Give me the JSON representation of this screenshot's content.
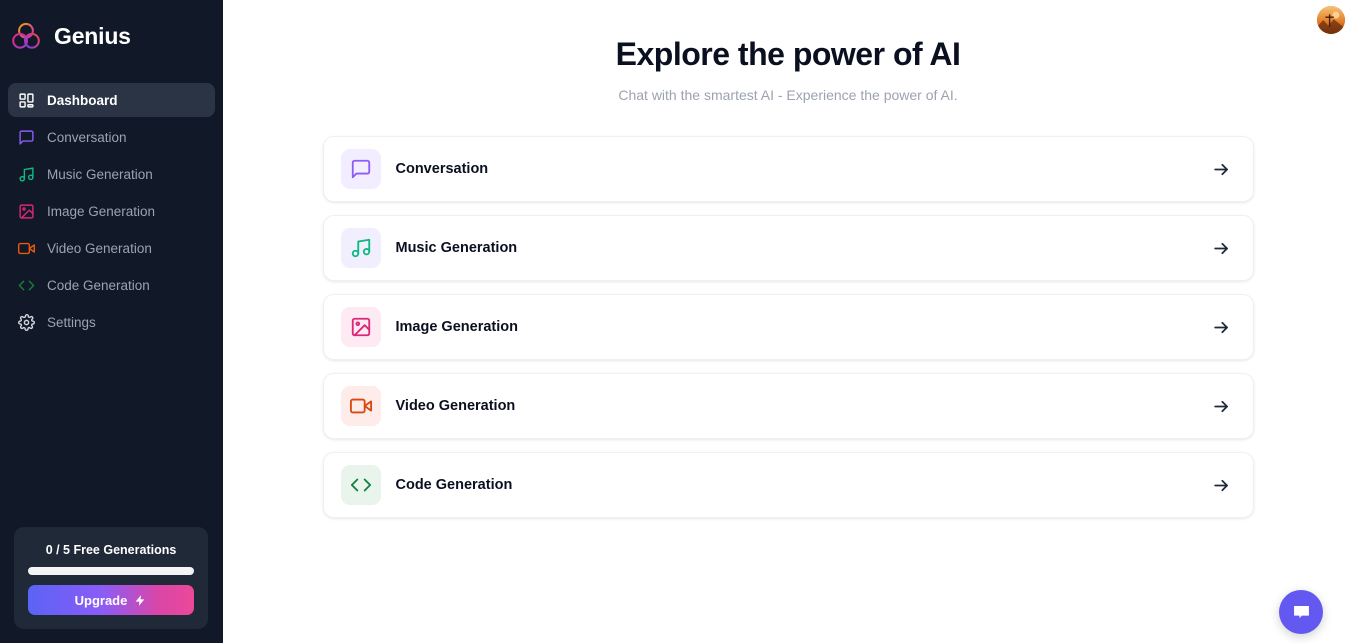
{
  "brand": {
    "name": "Genius",
    "logo_icon": "trefoil-circles-logo"
  },
  "sidebar": {
    "items": [
      {
        "label": "Dashboard",
        "icon": "layout-dashboard-icon",
        "active": true,
        "color": "#ffffff"
      },
      {
        "label": "Conversation",
        "icon": "message-square-icon",
        "active": false,
        "color": "#8b5cf6"
      },
      {
        "label": "Music Generation",
        "icon": "music-note-icon",
        "active": false,
        "color": "#10b981"
      },
      {
        "label": "Image Generation",
        "icon": "image-icon",
        "active": false,
        "color": "#db2777"
      },
      {
        "label": "Video Generation",
        "icon": "video-camera-icon",
        "active": false,
        "color": "#ea580c"
      },
      {
        "label": "Code Generation",
        "icon": "code-brackets-icon",
        "active": false,
        "color": "#15803d"
      },
      {
        "label": "Settings",
        "icon": "gear-icon",
        "active": false,
        "color": "#d1d5db"
      }
    ],
    "free_card": {
      "counter_text": "0 / 5 Free Generations",
      "progress_percent": 0,
      "upgrade_label": "Upgrade",
      "upgrade_icon": "zap-bolt-icon"
    }
  },
  "header": {
    "avatar_icon": "user-avatar"
  },
  "hero": {
    "title": "Explore the power of AI",
    "subtitle": "Chat with the smartest AI - Experience the power of AI."
  },
  "tools": [
    {
      "label": "Conversation",
      "icon": "message-square-icon",
      "icon_color": "#8b5cf6",
      "icon_bg": "#f3eeff",
      "arrow_icon": "arrow-right-icon"
    },
    {
      "label": "Music Generation",
      "icon": "music-note-icon",
      "icon_color": "#10b981",
      "icon_bg": "#f1eefe",
      "arrow_icon": "arrow-right-icon"
    },
    {
      "label": "Image Generation",
      "icon": "image-icon",
      "icon_color": "#db2777",
      "icon_bg": "#fdeaf3",
      "arrow_icon": "arrow-right-icon"
    },
    {
      "label": "Video Generation",
      "icon": "video-camera-icon",
      "icon_color": "#d9480f",
      "icon_bg": "#fdecea",
      "arrow_icon": "arrow-right-icon"
    },
    {
      "label": "Code Generation",
      "icon": "code-brackets-icon",
      "icon_color": "#15803d",
      "icon_bg": "#e9f4ec",
      "arrow_icon": "arrow-right-icon"
    }
  ],
  "chat_widget": {
    "icon": "chat-bubble-icon",
    "color": "#6359f0"
  },
  "colors": {
    "sidebar_bg": "#111827",
    "active_item_bg": "#2b3444",
    "main_bg": "#ffffff",
    "title_color": "#0b1020",
    "muted_text": "#9ca3af"
  }
}
